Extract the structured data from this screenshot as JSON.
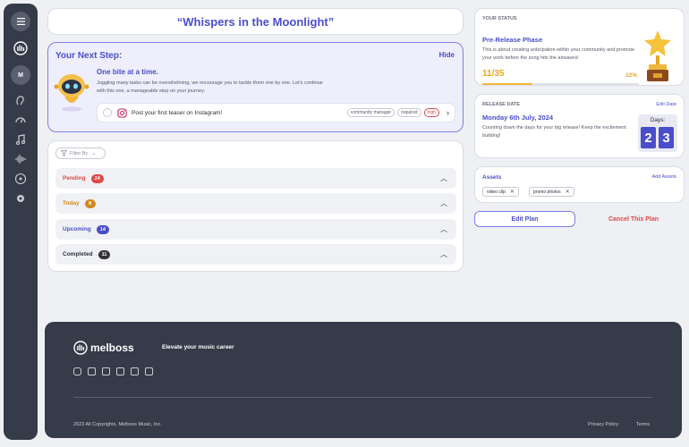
{
  "header": {
    "title": "“Whispers in the Moonlight”"
  },
  "sidebar": {
    "avatar_letter": "M"
  },
  "next_step": {
    "title": "Your Next Step:",
    "hide_label": "Hide",
    "headline": "One bite at a time.",
    "description": "Juggling many tasks can be overwhelming, we encourage you to tackle them one by one. Let’s continue with this one, a manageable step on your journey:",
    "task": {
      "text": "Post your first teaser on Instagram!",
      "tags": [
        "community manager",
        "required",
        "high"
      ]
    }
  },
  "tasks": {
    "filter_label": "Filter By",
    "groups": [
      {
        "label": "Pending",
        "count": "24",
        "color": "#e04848"
      },
      {
        "label": "Today",
        "count": "8",
        "color": "#d08a1c"
      },
      {
        "label": "Upcoming",
        "count": "14",
        "color": "#4a4ecb"
      },
      {
        "label": "Completed",
        "count": "11",
        "color": "#333333"
      }
    ]
  },
  "status": {
    "heading": "YOUR STATUS",
    "phase": "Pre-Release Phase",
    "description": "This is about creating anticipation within your community and promote your work before the song hits the airwaves!",
    "progress_text": "11/35",
    "percent_text": "32%",
    "progress_fraction": 0.32
  },
  "release": {
    "heading": "RELEASE DATE",
    "edit_label": "Edit Date",
    "date": "Monday 6th July, 2024",
    "description": "Counting down the days for your big release! Keep the excitement building!",
    "days_label": "Days:",
    "days_digits": [
      "2",
      "3"
    ]
  },
  "assets": {
    "title": "Assets",
    "add_label": "Add Assets",
    "items": [
      "video clip",
      "promo photos"
    ]
  },
  "actions": {
    "edit_plan": "Edit Plan",
    "cancel_plan": "Cancel This Plan"
  },
  "footer": {
    "brand": "melboss",
    "tagline": "Elevate your music career",
    "copyright": "2023 All Copyrights, Melboss Music, Inc.",
    "privacy": "Privacy Policy",
    "terms": "Terms",
    "social_icons": [
      "instagram-icon",
      "facebook-icon",
      "linkedin-icon",
      "youtube-icon",
      "twitter-icon",
      "tiktok-icon"
    ]
  }
}
